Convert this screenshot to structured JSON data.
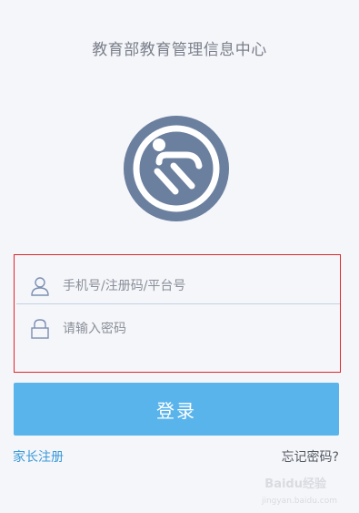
{
  "header": {
    "title": "教育部教育管理信息中心"
  },
  "logo": {
    "icon": "logo-icon",
    "color": "#6b7f9e"
  },
  "form": {
    "account_placeholder": "手机号/注册码/平台号",
    "account_icon": "user-icon",
    "password_placeholder": "请输入密码",
    "password_icon": "lock-icon",
    "highlight_color": "#e0262b"
  },
  "actions": {
    "login_label": "登录",
    "login_color": "#5ab4ec",
    "parent_register_label": "家长注册",
    "forgot_password_label": "忘记密码?"
  },
  "watermark": {
    "text": "Baidu经验",
    "subtext": "jingyan.baidu.com"
  }
}
